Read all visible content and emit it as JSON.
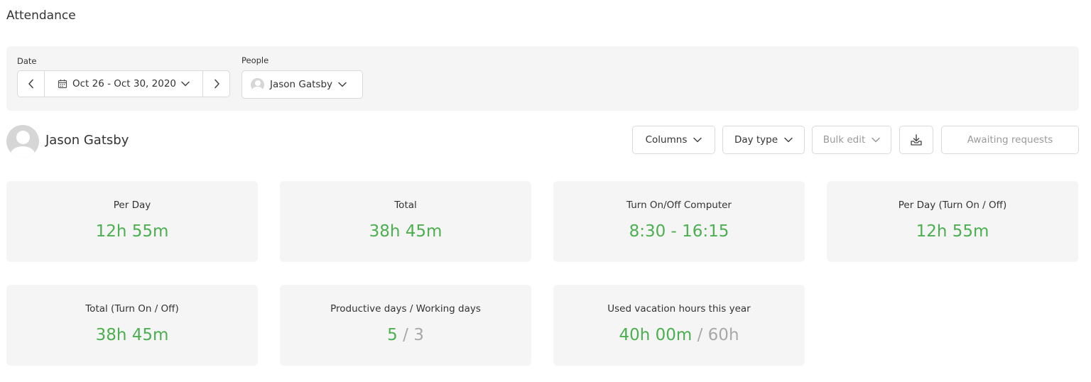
{
  "page": {
    "title": "Attendance"
  },
  "filters": {
    "date_label": "Date",
    "date_range": "Oct 26 - Oct 30, 2020",
    "people_label": "People",
    "people_selected": "Jason Gatsby"
  },
  "person": {
    "name": "Jason Gatsby"
  },
  "actions": {
    "columns": "Columns",
    "day_type": "Day type",
    "bulk_edit": "Bulk edit",
    "awaiting_requests": "Awaiting requests"
  },
  "stats": [
    {
      "label": "Per Day",
      "value": "12h 55m"
    },
    {
      "label": "Total",
      "value": "38h 45m"
    },
    {
      "label": "Turn On/Off Computer",
      "value": "8:30 - 16:15"
    },
    {
      "label": "Per Day (Turn On / Off)",
      "value": "12h 55m"
    },
    {
      "label": "Total (Turn On / Off)",
      "value": "38h 45m"
    },
    {
      "label": "Productive days / Working days",
      "value": "5",
      "separator": "/",
      "secondary": "3"
    },
    {
      "label": "Used vacation hours this year",
      "value": "40h 00m",
      "separator": "/",
      "secondary": "60h"
    }
  ],
  "colors": {
    "accent_green": "#4caf50",
    "muted_gray": "#a8a8a8",
    "panel_bg": "#f5f5f5",
    "border": "#d9d9d9"
  },
  "icons": {
    "prev": "chevron-left-icon",
    "next": "chevron-right-icon",
    "calendar": "calendar-icon",
    "dropdown": "chevron-down-icon",
    "export": "export-download-icon",
    "avatar": "user-avatar-placeholder"
  }
}
